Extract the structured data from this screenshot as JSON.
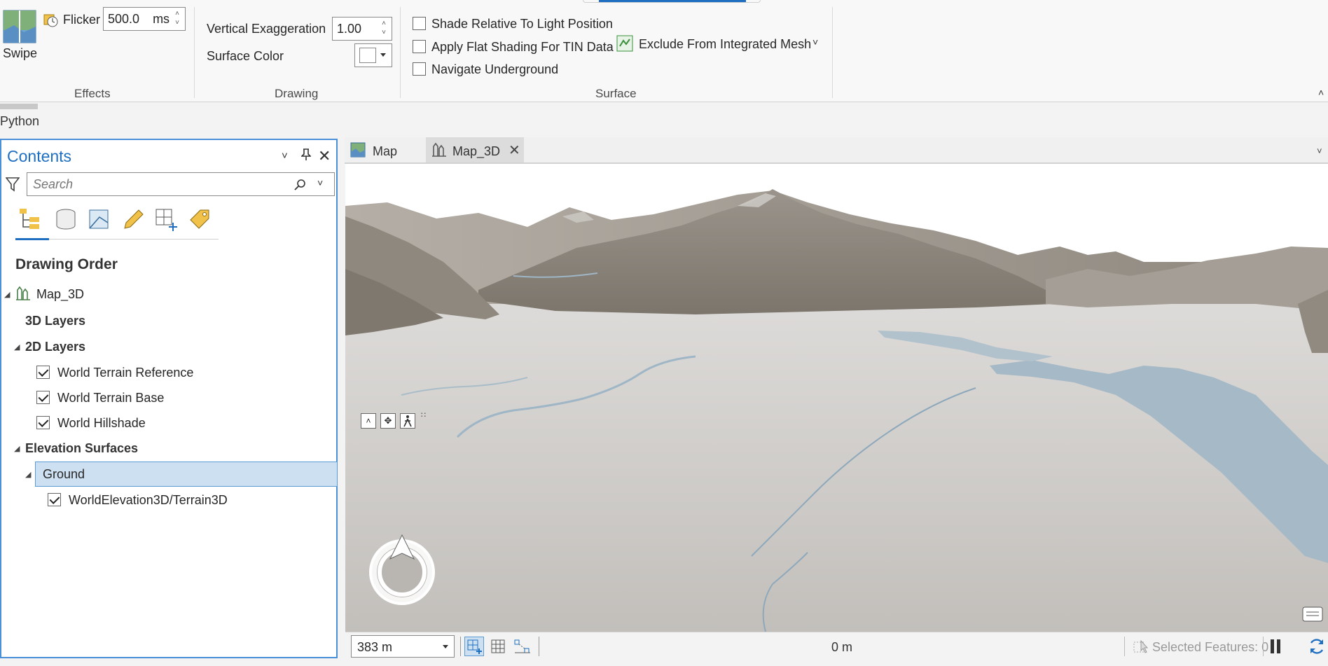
{
  "ribbon": {
    "effects": {
      "swipe_label": "Swipe",
      "flicker_label": "Flicker",
      "flicker_value": "500.0",
      "flicker_unit": "ms",
      "group_label": "Effects"
    },
    "drawing": {
      "vertical_exaggeration_label": "Vertical Exaggeration",
      "vertical_exaggeration_value": "1.00",
      "surface_color_label": "Surface Color",
      "group_label": "Drawing"
    },
    "surface": {
      "shade_relative_label": "Shade Relative To Light Position",
      "shade_relative_checked": false,
      "flat_shading_label": "Apply Flat Shading For TIN Data",
      "flat_shading_checked": false,
      "navigate_underground_label": "Navigate Underground",
      "navigate_underground_checked": false,
      "exclude_mesh_label": "Exclude From Integrated Mesh",
      "group_label": "Surface"
    }
  },
  "python_label": "Python",
  "contents": {
    "title": "Contents",
    "search_placeholder": "Search",
    "drawing_order_label": "Drawing Order",
    "map_name": "Map_3D",
    "layers_3d": "3D Layers",
    "layers_2d": "2D Layers",
    "layers_2d_items": [
      {
        "label": "World Terrain Reference",
        "checked": true
      },
      {
        "label": "World Terrain Base",
        "checked": true
      },
      {
        "label": "World Hillshade",
        "checked": true
      }
    ],
    "elevation_surfaces": "Elevation Surfaces",
    "ground_label": "Ground",
    "ground_items": [
      {
        "label": "WorldElevation3D/Terrain3D",
        "checked": true
      }
    ]
  },
  "map_tabs": [
    {
      "label": "Map",
      "active": false
    },
    {
      "label": "Map_3D",
      "active": true
    }
  ],
  "status": {
    "scale": "383 m",
    "elevation": "0 m",
    "selected_features": "Selected Features: 0"
  },
  "colors": {
    "accent": "#1e6fc1",
    "selection_fill": "#cde0f2",
    "terrain_plain": "#c9c6c2",
    "mountain": "#8a8278",
    "water": "#9fb6c6"
  }
}
